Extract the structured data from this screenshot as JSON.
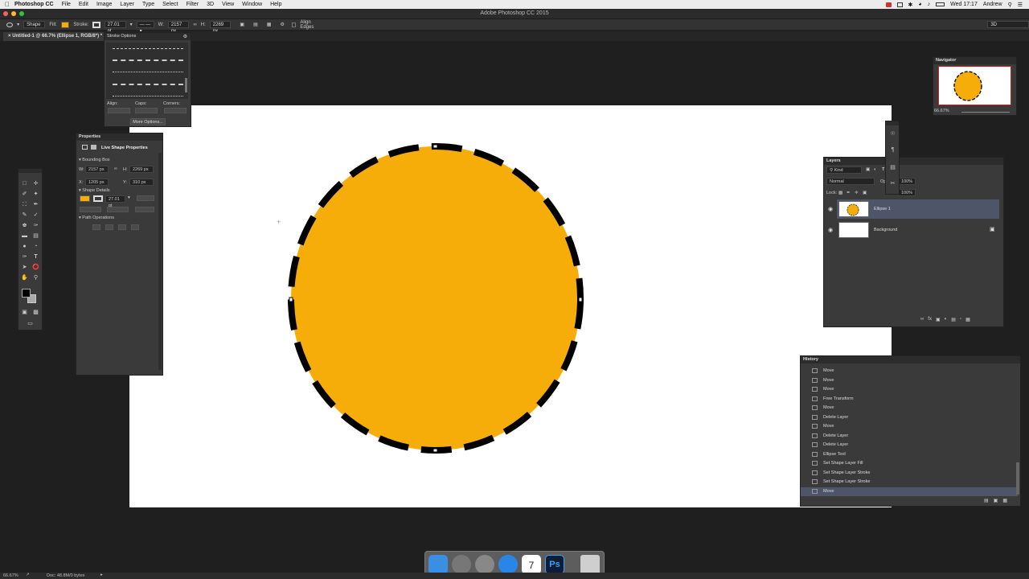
{
  "menubar": {
    "app": "Photoshop CC",
    "items": [
      "File",
      "Edit",
      "Image",
      "Layer",
      "Type",
      "Select",
      "Filter",
      "3D",
      "View",
      "Window",
      "Help"
    ],
    "clock": "Wed 17:17",
    "user": "Andrew"
  },
  "window": {
    "title": "Adobe Photoshop CC 2015"
  },
  "options": {
    "mode": "Shape",
    "fill_label": "Fill:",
    "stroke_label": "Stroke:",
    "stroke_width": "27.01 pt",
    "w_label": "W:",
    "w_value": "2157 px",
    "h_label": "H:",
    "h_value": "2269 px",
    "align_edges": "Align Edges",
    "workspace": "3D",
    "fill_color": "#f6ad0a"
  },
  "document": {
    "tab": "Untitled-1 @ 66.7% (Ellipse 1, RGB/8*) *"
  },
  "stroke_options": {
    "title": "Stroke Options",
    "align_label": "Align:",
    "caps_label": "Caps:",
    "corners_label": "Corners:",
    "more_button": "More Options..."
  },
  "properties": {
    "title": "Properties",
    "header": "Live Shape Properties",
    "bounding_box": "Bounding Box",
    "w_label": "W:",
    "w_value": "2157 px",
    "h_label": "H:",
    "h_value": "2269 px",
    "x_label": "X:",
    "x_value": "1205 px",
    "y_label": "Y:",
    "y_value": "310 px",
    "shape_details": "Shape Details",
    "stroke_width": "27.01 pt",
    "path_operations": "Path Operations"
  },
  "navigator": {
    "title": "Navigator",
    "zoom": "66.67%"
  },
  "layers": {
    "title": "Layers",
    "filter": "Kind",
    "blend_mode": "Normal",
    "opacity_label": "Op",
    "opacity_value": "100%",
    "lock_label": "Lock:",
    "fill_label": "Fill:",
    "fill_value": "100%",
    "items": [
      {
        "name": "Ellipse 1",
        "selected": true
      },
      {
        "name": "Background",
        "selected": false
      }
    ]
  },
  "history": {
    "title": "History",
    "items": [
      "Move",
      "Move",
      "Move",
      "Free Transform",
      "Move",
      "Delete Layer",
      "Move",
      "Delete Layer",
      "Delete Layer",
      "Ellipse Tool",
      "Set Shape Layer Fill",
      "Set Shape Layer Stroke",
      "Set Shape Layer Stroke",
      "Move"
    ]
  },
  "status": {
    "zoom": "66.67%",
    "doc": "Doc: 48.8M/0 bytes"
  }
}
